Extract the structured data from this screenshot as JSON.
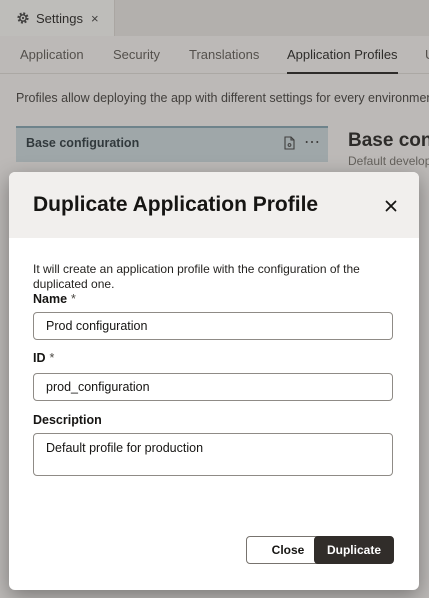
{
  "doc_tab": {
    "title": "Settings",
    "close_glyph": "×",
    "icon": "gear-icon"
  },
  "nav_tabs": [
    {
      "label": "Application",
      "active": false
    },
    {
      "label": "Security",
      "active": false
    },
    {
      "label": "Translations",
      "active": false
    },
    {
      "label": "Application Profiles",
      "active": true
    },
    {
      "label": "U",
      "active": false
    }
  ],
  "hint_text": "Profiles allow deploying the app with different settings for every environment",
  "profile_card": {
    "title": "Base configuration",
    "more_glyph": "⋯"
  },
  "side_panel": {
    "title": "Base conf",
    "subtitle": "Default develop"
  },
  "dialog": {
    "title": "Duplicate Application Profile",
    "close_glyph": "✕",
    "description": "It will create an application profile with the configuration of the duplicated one.",
    "name_label": "Name",
    "name_value": "Prod configuration",
    "id_label": "ID",
    "id_value": "prod_configuration",
    "required_mark": "*",
    "description_label": "Description",
    "description_value": "Default profile for production",
    "close_button": "Close",
    "duplicate_button": "Duplicate"
  },
  "colors": {
    "primary_button": "#312d2a",
    "card_selected": "#c5d3d8",
    "header_bg": "#f1efed"
  }
}
